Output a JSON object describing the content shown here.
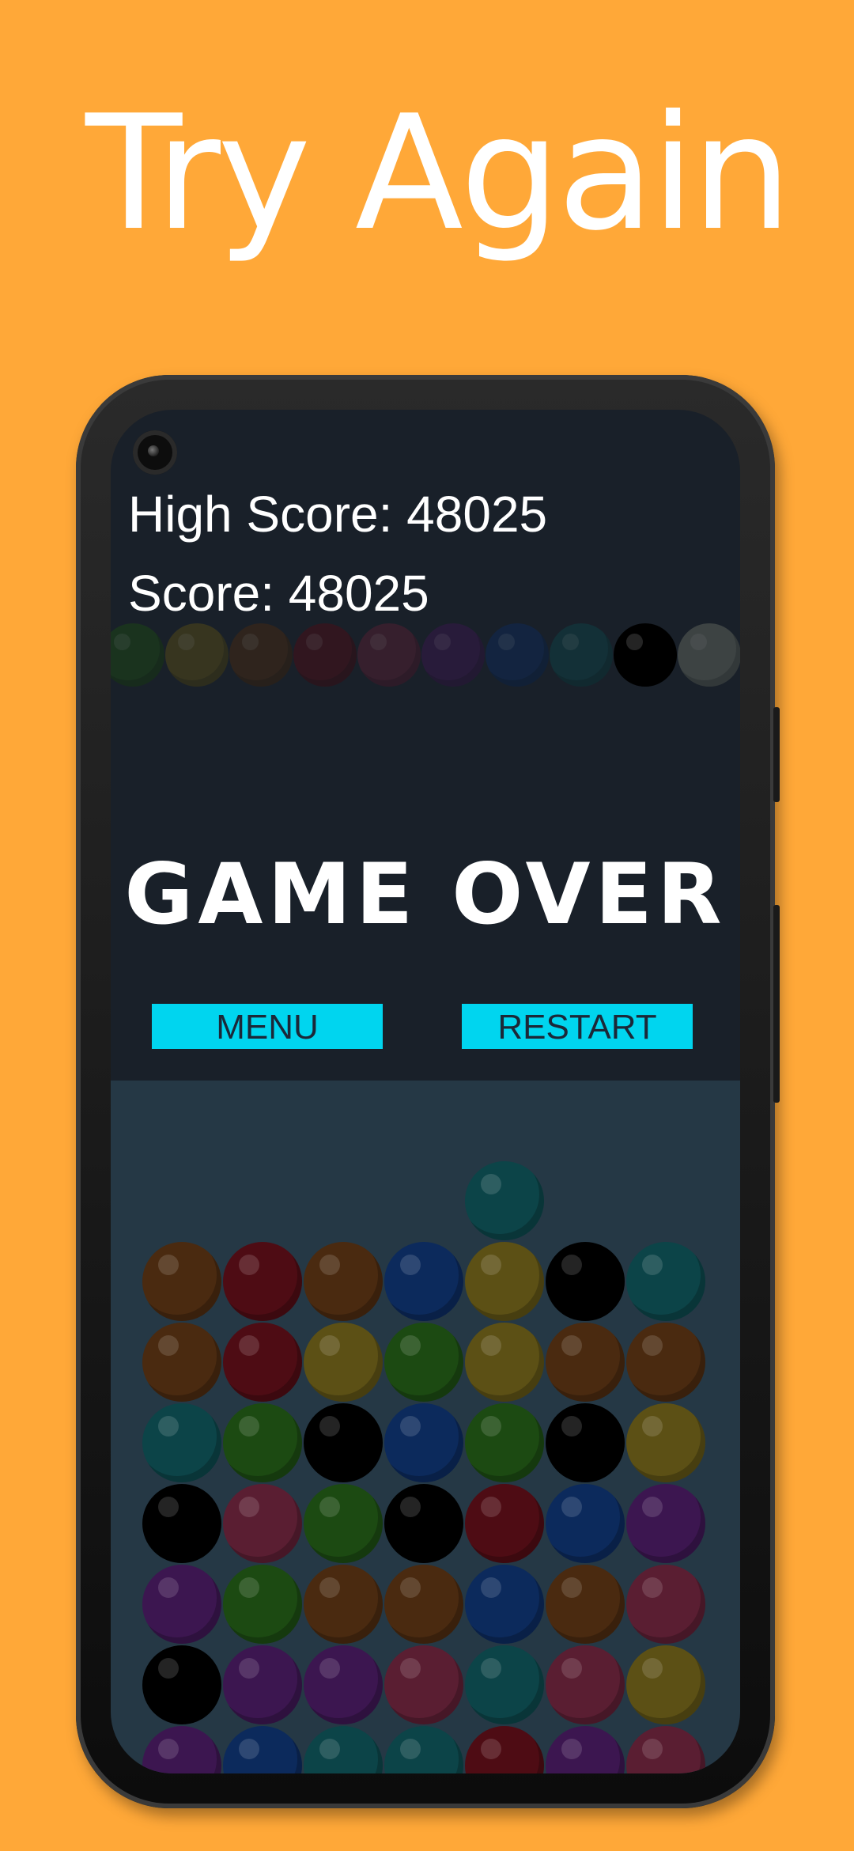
{
  "headline": "Try Again",
  "hud": {
    "high_score_text": "High Score: 48025",
    "score_text": "Score: 48025"
  },
  "overlay": {
    "title": "GAME OVER",
    "menu_label": "MENU",
    "restart_label": "RESTART"
  },
  "colors": {
    "background": "#FFA838",
    "screen": "#192029",
    "board": "#253845",
    "button": "#00D5EF",
    "ball_palette": {
      "green": "#1c4a12",
      "yellow": "#5c5015",
      "brown": "#4a2a10",
      "red": "#4e0c14",
      "pink": "#5a1e32",
      "purple": "#3c1650",
      "blue": "#0c2a5c",
      "teal": "#0c4448",
      "black": "#000000",
      "gray": "#6a6f64"
    }
  },
  "next_balls_preview": [
    "green",
    "yellow",
    "brown",
    "red",
    "pink",
    "purple",
    "blue",
    "teal",
    "black",
    "gray"
  ],
  "falling_ball": "teal",
  "board_grid": [
    [
      "brown",
      "red",
      "brown",
      "blue",
      "yellow",
      "black",
      "teal"
    ],
    [
      "brown",
      "red",
      "yellow",
      "green",
      "yellow",
      "brown",
      "brown"
    ],
    [
      "teal",
      "green",
      "black",
      "blue",
      "green",
      "black",
      "yellow"
    ],
    [
      "black",
      "pink",
      "green",
      "black",
      "red",
      "blue",
      "purple"
    ],
    [
      "purple",
      "green",
      "brown",
      "brown",
      "blue",
      "brown",
      "pink"
    ],
    [
      "black",
      "purple",
      "purple",
      "pink",
      "teal",
      "pink",
      "yellow"
    ],
    [
      "purple",
      "blue",
      "teal",
      "teal",
      "red",
      "purple",
      "pink"
    ]
  ]
}
